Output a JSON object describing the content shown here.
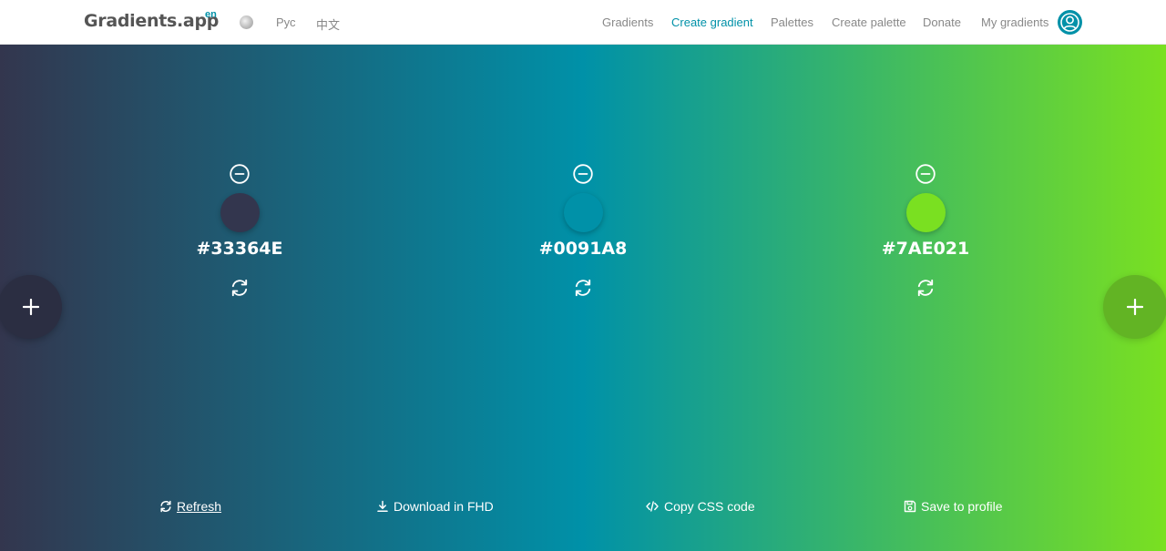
{
  "header": {
    "logo": "Gradients.app",
    "logo_sup": "en",
    "languages": [
      "Рус",
      "中文"
    ],
    "nav": [
      "Gradients",
      "Create gradient",
      "Palettes",
      "Create palette",
      "Donate",
      "My gradients"
    ],
    "active_nav": "Create gradient",
    "accent_color": "#0091A8"
  },
  "gradient": {
    "direction": "to right",
    "stops": [
      {
        "hex": "#33364E"
      },
      {
        "hex": "#0091A8"
      },
      {
        "hex": "#7AE021"
      }
    ]
  },
  "actions": {
    "refresh": "Refresh",
    "download": "Download in FHD",
    "copy_css": "Copy CSS code",
    "save": "Save to profile"
  },
  "icons": {
    "remove": "minus-circle-icon",
    "shuffle": "refresh-icon",
    "add": "plus-icon",
    "download": "download-icon",
    "code": "code-icon",
    "save": "floppy-disk-icon",
    "avatar": "user-icon"
  }
}
